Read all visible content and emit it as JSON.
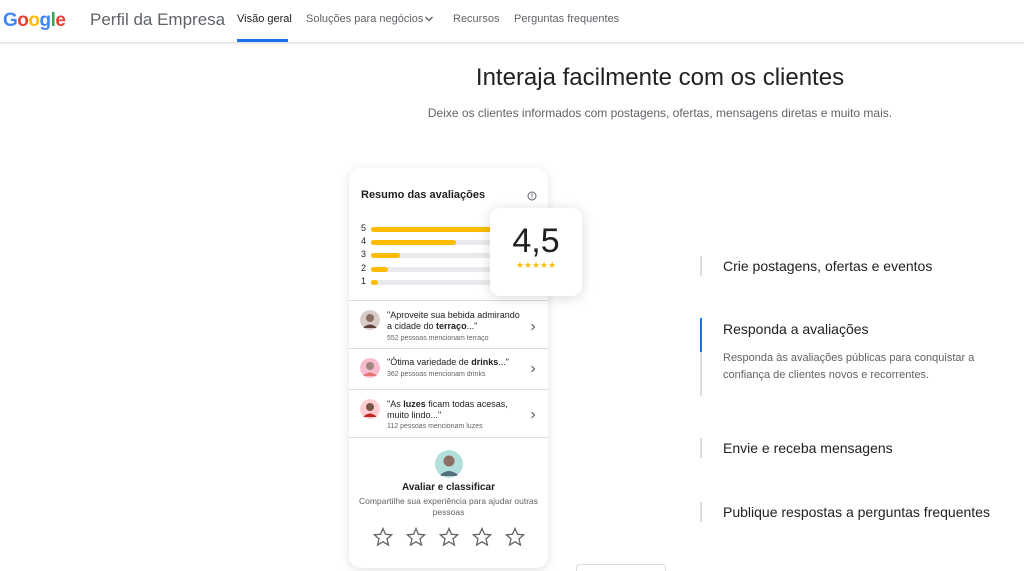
{
  "header": {
    "logo_letters": [
      {
        "ch": "G",
        "color": "#4285F4"
      },
      {
        "ch": "o",
        "color": "#EA4335"
      },
      {
        "ch": "o",
        "color": "#FBBC05"
      },
      {
        "ch": "g",
        "color": "#4285F4"
      },
      {
        "ch": "l",
        "color": "#34A853"
      },
      {
        "ch": "e",
        "color": "#EA4335"
      }
    ],
    "brand": "Perfil da Empresa",
    "nav": [
      "Visão geral",
      "Soluções para negócios",
      "Recursos",
      "Perguntas frequentes"
    ]
  },
  "hero": {
    "title": "Interaja facilmente com os clientes",
    "subtitle": "Deixe os clientes informados com postagens, ofertas, mensagens diretas e muito mais."
  },
  "card": {
    "title": "Resumo das avaliações",
    "bars": [
      {
        "label": "5",
        "fraction": 0.9
      },
      {
        "label": "4",
        "fraction": 0.5
      },
      {
        "label": "3",
        "fraction": 0.17
      },
      {
        "label": "2",
        "fraction": 0.1
      },
      {
        "label": "1",
        "fraction": 0.04
      }
    ],
    "rating": "4,5",
    "rating_stars": "★★★★★",
    "reviews": [
      {
        "text_pre": "\"Aproveite sua bebida admirando a cidade do ",
        "bold": "terraço",
        "text_post": "...\"",
        "meta": "552 pessoas mencionam terraço"
      },
      {
        "text_pre": "\"Ótima variedade de ",
        "bold": "drinks",
        "text_post": "...\"",
        "meta": "362 pessoas mencionam drinks"
      },
      {
        "text_pre": "\"As ",
        "bold": "luzes",
        "text_post": " ficam todas acesas, muito lindo...\"",
        "meta": "112 pessoas mencionam luzes"
      }
    ],
    "rate_title": "Avaliar e classificar",
    "rate_sub": "Compartilhe sua experiência para ajudar outras pessoas"
  },
  "features": [
    {
      "title": "Crie postagens, ofertas e eventos",
      "desc": "",
      "active": false
    },
    {
      "title": "Responda a avaliações",
      "desc": "Responda às avaliações públicas para conquistar a confiança de clientes novos e recorrentes.",
      "active": true
    },
    {
      "title": "Envie e receba mensagens",
      "desc": "",
      "active": false
    },
    {
      "title": "Publique respostas a perguntas frequentes",
      "desc": "",
      "active": false
    }
  ],
  "colors": {
    "accent": "#1a73e8",
    "star": "#fbbc04"
  }
}
